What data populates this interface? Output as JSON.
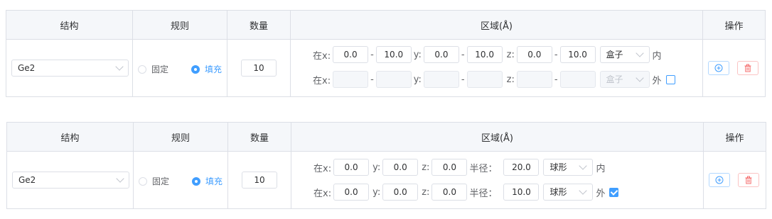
{
  "headers": {
    "structure": "结构",
    "rule": "规则",
    "count": "数量",
    "region": "区域(Å)",
    "actions": "操作"
  },
  "colors": {
    "accent": "#409eff",
    "danger": "#f56c6c",
    "border": "#dcdfe6"
  },
  "table1": {
    "structure": "Ge2",
    "rule_fixed": "固定",
    "rule_fill": "填充",
    "selected_rule": "填充",
    "count": "10",
    "row1": {
      "prefix": "在x:",
      "x_min": "0.0",
      "x_max": "10.0",
      "y_label": "y:",
      "y_min": "0.0",
      "y_max": "10.0",
      "z_label": "z:",
      "z_min": "0.0",
      "z_max": "10.0",
      "shape": "盒子",
      "suffix": "内"
    },
    "row2": {
      "prefix": "在x:",
      "x_min": "",
      "x_max": "",
      "y_label": "y:",
      "y_min": "",
      "y_max": "",
      "z_label": "z:",
      "z_min": "",
      "z_max": "",
      "shape": "盒子",
      "suffix": "外",
      "checked": false
    }
  },
  "table2": {
    "structure": "Ge2",
    "rule_fixed": "固定",
    "rule_fill": "填充",
    "selected_rule": "填充",
    "count": "10",
    "row1": {
      "prefix": "在x:",
      "x": "0.0",
      "y_label": "y:",
      "y": "0.0",
      "z_label": "z:",
      "z": "0.0",
      "radius_label": "半径：",
      "radius": "20.0",
      "shape": "球形",
      "suffix": "内"
    },
    "row2": {
      "prefix": "在x:",
      "x": "0.0",
      "y_label": "y:",
      "y": "0.0",
      "z_label": "z:",
      "z": "0.0",
      "radius_label": "半径：",
      "radius": "10.0",
      "shape": "球形",
      "suffix": "外",
      "checked": true
    }
  },
  "icons": {
    "add": "plus-circle-icon",
    "delete": "trash-icon"
  }
}
